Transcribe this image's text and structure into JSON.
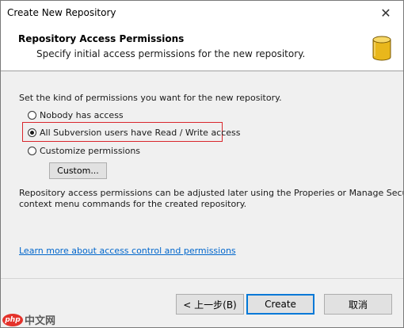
{
  "window": {
    "title": "Create New Repository",
    "close_glyph": "✕"
  },
  "header": {
    "title": "Repository Access Permissions",
    "subtitle": "Specify initial access permissions for the new repository.",
    "icon": "database-icon"
  },
  "permissions": {
    "prompt": "Set the kind of permissions you want for the new repository.",
    "options": [
      {
        "label": "Nobody has access",
        "checked": false
      },
      {
        "label": "All Subversion users have Read / Write access",
        "checked": true
      },
      {
        "label": "Customize permissions",
        "checked": false
      }
    ],
    "custom_button": "Custom...",
    "note_line1": "Repository access permissions can be adjusted later using the Properies or Manage Security",
    "note_line2": "context menu commands for the created repository."
  },
  "help_link": "Learn more about access control and permissions",
  "buttons": {
    "back": "< 上一步(B)",
    "create": "Create",
    "cancel": "取消"
  },
  "watermark": {
    "logo": "php",
    "text": "中文网"
  },
  "colors": {
    "highlight": "#d9262c",
    "link": "#0066cc",
    "default_button_border": "#0078d7",
    "icon_gold": "#e9b71b"
  }
}
